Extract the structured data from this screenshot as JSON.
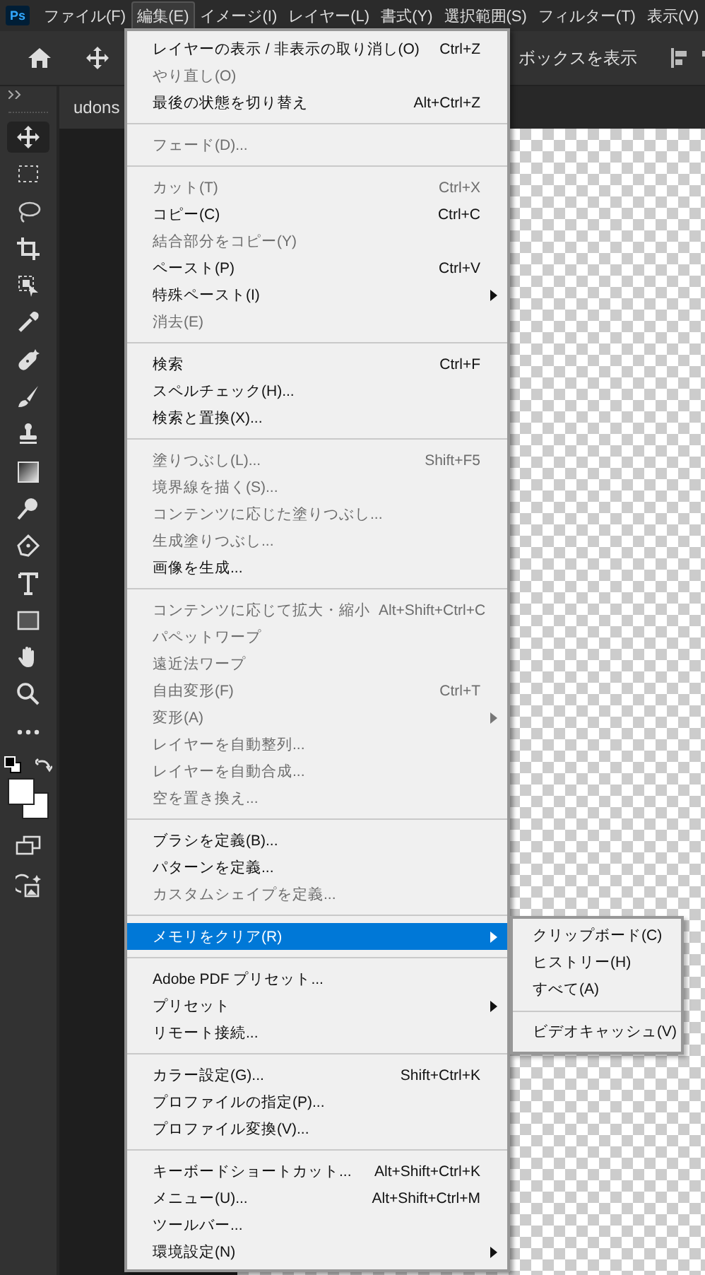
{
  "app_icon": {
    "label": "Ps"
  },
  "menu_bar": [
    {
      "label": "ファイル(F)",
      "selected": false
    },
    {
      "label": "編集(E)",
      "selected": true
    },
    {
      "label": "イメージ(I)",
      "selected": false
    },
    {
      "label": "レイヤー(L)",
      "selected": false
    },
    {
      "label": "書式(Y)",
      "selected": false
    },
    {
      "label": "選択範囲(S)",
      "selected": false
    },
    {
      "label": "フィルター(T)",
      "selected": false
    },
    {
      "label": "表示(V)",
      "selected": false
    }
  ],
  "options_bar": {
    "option_text": "ボックスを表示"
  },
  "document_tab": {
    "title": "udons"
  },
  "toolbar": {
    "tools": [
      {
        "kind": "move",
        "selected": true
      },
      {
        "kind": "marquee",
        "selected": false
      },
      {
        "kind": "lasso",
        "selected": false
      },
      {
        "kind": "crop",
        "selected": false
      },
      {
        "kind": "object-select",
        "selected": false
      },
      {
        "kind": "eyedropper",
        "selected": false
      },
      {
        "kind": "healing",
        "selected": false
      },
      {
        "kind": "brush",
        "selected": false
      },
      {
        "kind": "stamp",
        "selected": false
      },
      {
        "kind": "gradient",
        "selected": false
      },
      {
        "kind": "dodge",
        "selected": false
      },
      {
        "kind": "pen",
        "selected": false
      },
      {
        "kind": "type",
        "selected": false
      },
      {
        "kind": "rectangle",
        "selected": false
      },
      {
        "kind": "hand",
        "selected": false
      },
      {
        "kind": "zoom",
        "selected": false
      },
      {
        "kind": "more",
        "selected": false
      }
    ]
  },
  "edit_menu": {
    "items": [
      {
        "kind": "item",
        "label": "レイヤーの表示 / 非表示の取り消し(O)",
        "shortcut": "Ctrl+Z",
        "disabled": false,
        "submenu": false,
        "selected": false
      },
      {
        "kind": "item",
        "label": "やり直し(O)",
        "disabled": true,
        "submenu": false,
        "selected": false
      },
      {
        "kind": "item",
        "label": "最後の状態を切り替え",
        "shortcut": "Alt+Ctrl+Z",
        "disabled": false,
        "submenu": false,
        "selected": false
      },
      {
        "kind": "separator"
      },
      {
        "kind": "item",
        "label": "フェード(D)...",
        "disabled": true,
        "submenu": false,
        "selected": false
      },
      {
        "kind": "separator"
      },
      {
        "kind": "item",
        "label": "カット(T)",
        "shortcut": "Ctrl+X",
        "disabled": true,
        "submenu": false,
        "selected": false
      },
      {
        "kind": "item",
        "label": "コピー(C)",
        "shortcut": "Ctrl+C",
        "disabled": false,
        "submenu": false,
        "selected": false
      },
      {
        "kind": "item",
        "label": "結合部分をコピー(Y)",
        "disabled": true,
        "submenu": false,
        "selected": false
      },
      {
        "kind": "item",
        "label": "ペースト(P)",
        "shortcut": "Ctrl+V",
        "disabled": false,
        "submenu": false,
        "selected": false
      },
      {
        "kind": "item",
        "label": "特殊ペースト(I)",
        "disabled": false,
        "submenu": true,
        "selected": false
      },
      {
        "kind": "item",
        "label": "消去(E)",
        "disabled": true,
        "submenu": false,
        "selected": false
      },
      {
        "kind": "separator"
      },
      {
        "kind": "item",
        "label": "検索",
        "shortcut": "Ctrl+F",
        "disabled": false,
        "submenu": false,
        "selected": false
      },
      {
        "kind": "item",
        "label": "スペルチェック(H)...",
        "disabled": false,
        "submenu": false,
        "selected": false
      },
      {
        "kind": "item",
        "label": "検索と置換(X)...",
        "disabled": false,
        "submenu": false,
        "selected": false
      },
      {
        "kind": "separator"
      },
      {
        "kind": "item",
        "label": "塗りつぶし(L)...",
        "shortcut": "Shift+F5",
        "disabled": true,
        "submenu": false,
        "selected": false
      },
      {
        "kind": "item",
        "label": "境界線を描く(S)...",
        "disabled": true,
        "submenu": false,
        "selected": false
      },
      {
        "kind": "item",
        "label": "コンテンツに応じた塗りつぶし...",
        "disabled": true,
        "submenu": false,
        "selected": false
      },
      {
        "kind": "item",
        "label": "生成塗りつぶし...",
        "disabled": true,
        "submenu": false,
        "selected": false
      },
      {
        "kind": "item",
        "label": "画像を生成...",
        "disabled": false,
        "submenu": false,
        "selected": false
      },
      {
        "kind": "separator"
      },
      {
        "kind": "item",
        "label": "コンテンツに応じて拡大・縮小",
        "shortcut": "Alt+Shift+Ctrl+C",
        "disabled": true,
        "submenu": false,
        "selected": false
      },
      {
        "kind": "item",
        "label": "パペットワープ",
        "disabled": true,
        "submenu": false,
        "selected": false
      },
      {
        "kind": "item",
        "label": "遠近法ワープ",
        "disabled": true,
        "submenu": false,
        "selected": false
      },
      {
        "kind": "item",
        "label": "自由変形(F)",
        "shortcut": "Ctrl+T",
        "disabled": true,
        "submenu": false,
        "selected": false
      },
      {
        "kind": "item",
        "label": "変形(A)",
        "disabled": true,
        "submenu": true,
        "selected": false
      },
      {
        "kind": "item",
        "label": "レイヤーを自動整列...",
        "disabled": true,
        "submenu": false,
        "selected": false
      },
      {
        "kind": "item",
        "label": "レイヤーを自動合成...",
        "disabled": true,
        "submenu": false,
        "selected": false
      },
      {
        "kind": "item",
        "label": "空を置き換え...",
        "disabled": true,
        "submenu": false,
        "selected": false
      },
      {
        "kind": "separator"
      },
      {
        "kind": "item",
        "label": "ブラシを定義(B)...",
        "disabled": false,
        "submenu": false,
        "selected": false
      },
      {
        "kind": "item",
        "label": "パターンを定義...",
        "disabled": false,
        "submenu": false,
        "selected": false
      },
      {
        "kind": "item",
        "label": "カスタムシェイプを定義...",
        "disabled": true,
        "submenu": false,
        "selected": false
      },
      {
        "kind": "separator"
      },
      {
        "kind": "item",
        "label": "メモリをクリア(R)",
        "disabled": false,
        "submenu": true,
        "selected": true
      },
      {
        "kind": "separator"
      },
      {
        "kind": "item",
        "label": "Adobe PDF プリセット...",
        "disabled": false,
        "submenu": false,
        "selected": false
      },
      {
        "kind": "item",
        "label": "プリセット",
        "disabled": false,
        "submenu": true,
        "selected": false
      },
      {
        "kind": "item",
        "label": "リモート接続...",
        "disabled": false,
        "submenu": false,
        "selected": false
      },
      {
        "kind": "separator"
      },
      {
        "kind": "item",
        "label": "カラー設定(G)...",
        "shortcut": "Shift+Ctrl+K",
        "disabled": false,
        "submenu": false,
        "selected": false
      },
      {
        "kind": "item",
        "label": "プロファイルの指定(P)...",
        "disabled": false,
        "submenu": false,
        "selected": false
      },
      {
        "kind": "item",
        "label": "プロファイル変換(V)...",
        "disabled": false,
        "submenu": false,
        "selected": false
      },
      {
        "kind": "separator"
      },
      {
        "kind": "item",
        "label": "キーボードショートカット...",
        "shortcut": "Alt+Shift+Ctrl+K",
        "disabled": false,
        "submenu": false,
        "selected": false
      },
      {
        "kind": "item",
        "label": "メニュー(U)...",
        "shortcut": "Alt+Shift+Ctrl+M",
        "disabled": false,
        "submenu": false,
        "selected": false
      },
      {
        "kind": "item",
        "label": "ツールバー...",
        "disabled": false,
        "submenu": false,
        "selected": false
      },
      {
        "kind": "item",
        "label": "環境設定(N)",
        "disabled": false,
        "submenu": true,
        "selected": false
      }
    ]
  },
  "clear_memory_submenu": {
    "items": [
      {
        "kind": "item",
        "label": "クリップボード(C)",
        "disabled": false
      },
      {
        "kind": "item",
        "label": "ヒストリー(H)",
        "disabled": false
      },
      {
        "kind": "item",
        "label": "すべて(A)",
        "disabled": false
      },
      {
        "kind": "separator"
      },
      {
        "kind": "item",
        "label": "ビデオキャッシュ(V)",
        "disabled": false
      }
    ]
  }
}
